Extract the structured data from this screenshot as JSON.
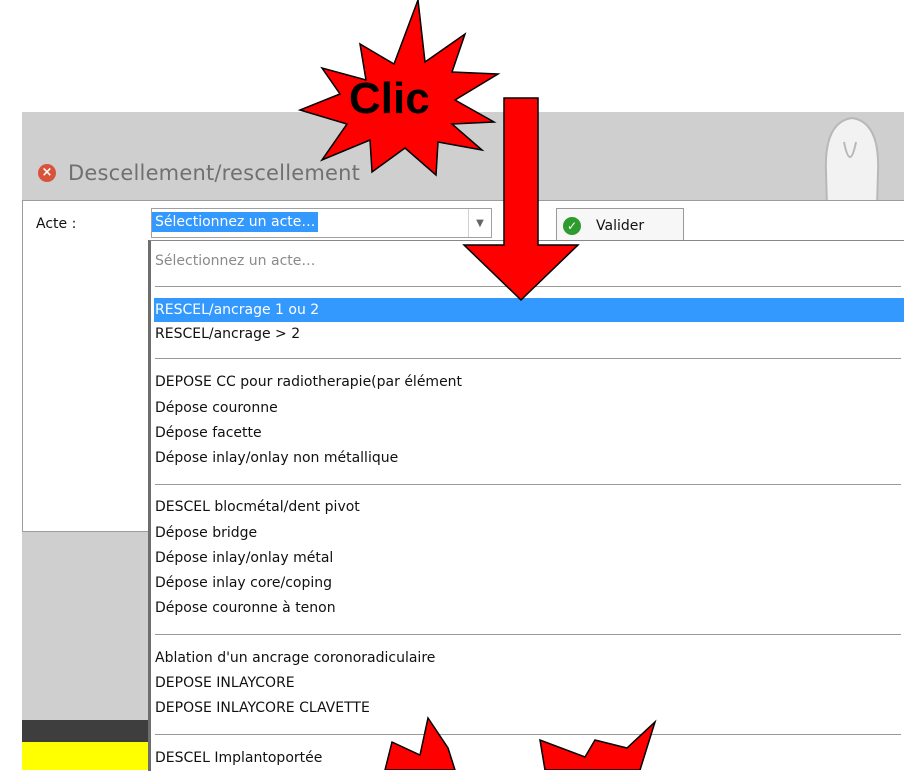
{
  "window": {
    "title": "Descellement/rescellement"
  },
  "form": {
    "acte_label": "Acte :",
    "selected_value": "Sélectionnez un acte…",
    "valider_label": "Valider"
  },
  "dropdown": {
    "placeholder": "Sélectionnez un acte…",
    "groups": [
      [
        "RESCEL/ancrage 1 ou 2",
        "RESCEL/ancrage > 2"
      ],
      [
        "DEPOSE CC pour radiotherapie(par élément",
        "Dépose couronne",
        "Dépose facette",
        "Dépose inlay/onlay non métallique"
      ],
      [
        "DESCEL blocmétal/dent pivot",
        "Dépose bridge",
        "Dépose inlay/onlay métal",
        "Dépose inlay core/coping",
        "Dépose couronne à tenon"
      ],
      [
        "Ablation d'un ancrage coronoradiculaire",
        "DEPOSE INLAYCORE",
        "DEPOSE INLAYCORE CLAVETTE"
      ],
      [
        "DESCEL Implantoportée"
      ]
    ],
    "highlighted_item": "RESCEL/ancrage 1 ou 2"
  },
  "annotation": {
    "callout_text": "Clic",
    "colors": {
      "burst": "#ff0000",
      "arrow": "#ff0000"
    }
  }
}
